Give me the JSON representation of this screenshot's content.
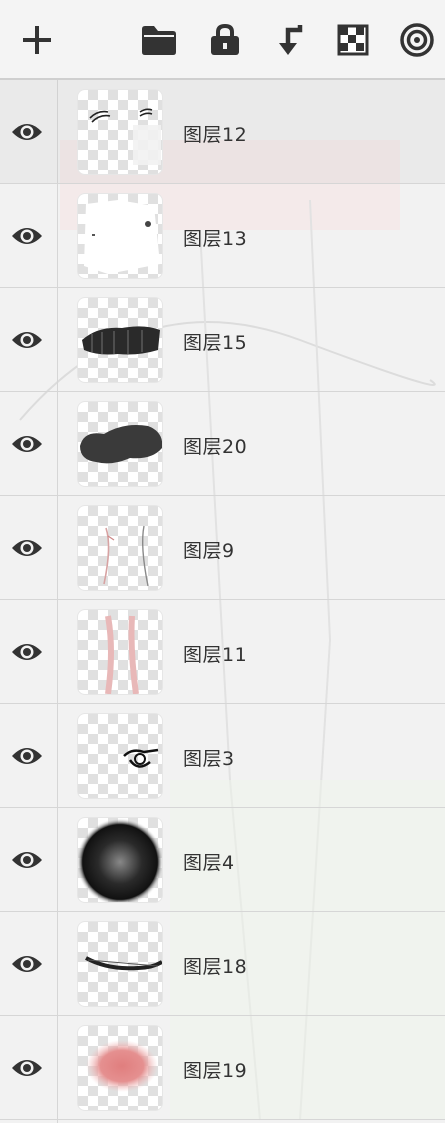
{
  "toolbar": {
    "buttons": [
      {
        "name": "add-layer-button",
        "icon": "plus-icon"
      },
      {
        "name": "folder-button",
        "icon": "folder-icon"
      },
      {
        "name": "lock-button",
        "icon": "lock-icon"
      },
      {
        "name": "merge-down-button",
        "icon": "arrow-down-left-icon"
      },
      {
        "name": "transparency-button",
        "icon": "checkerboard-icon"
      },
      {
        "name": "target-button",
        "icon": "target-icon"
      }
    ]
  },
  "layers": [
    {
      "name": "图层12",
      "visible": true,
      "thumb": "lashes"
    },
    {
      "name": "图层13",
      "visible": true,
      "thumb": "white-shirt"
    },
    {
      "name": "图层15",
      "visible": true,
      "thumb": "black-stroke"
    },
    {
      "name": "图层20",
      "visible": true,
      "thumb": "black-blob"
    },
    {
      "name": "图层9",
      "visible": true,
      "thumb": "legs-lines"
    },
    {
      "name": "图层11",
      "visible": true,
      "thumb": "legs-pink"
    },
    {
      "name": "图层3",
      "visible": true,
      "thumb": "eye-sketch"
    },
    {
      "name": "图层4",
      "visible": true,
      "thumb": "dark-ball"
    },
    {
      "name": "图层18",
      "visible": true,
      "thumb": "line-stroke"
    },
    {
      "name": "图层19",
      "visible": true,
      "thumb": "pink-blob"
    }
  ],
  "colors": {
    "icon": "#333333",
    "accent_pink": "#e08a8a"
  }
}
